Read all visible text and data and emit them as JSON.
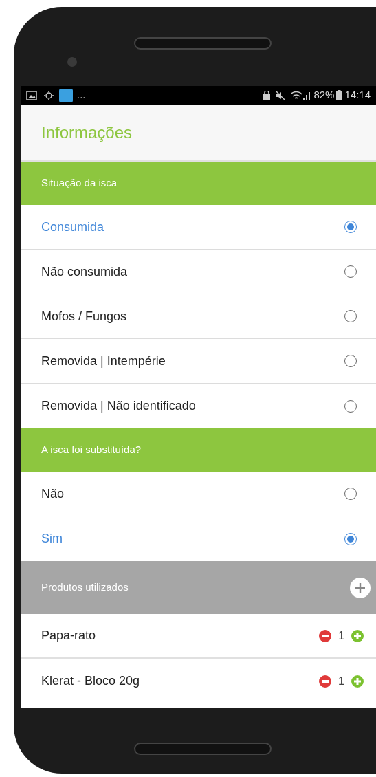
{
  "status_bar": {
    "overflow": "...",
    "battery": "82%",
    "time": "14:14"
  },
  "header": {
    "title": "Informações"
  },
  "sections": [
    {
      "kind": "radio",
      "title": "Situação da isca",
      "options": [
        {
          "label": "Consumida",
          "selected": true
        },
        {
          "label": "Não consumida",
          "selected": false
        },
        {
          "label": "Mofos / Fungos",
          "selected": false
        },
        {
          "label": "Removida | Intempérie",
          "selected": false
        },
        {
          "label": "Removida | Não identificado",
          "selected": false
        }
      ]
    },
    {
      "kind": "radio",
      "title": "A isca foi substituída?",
      "options": [
        {
          "label": "Não",
          "selected": false
        },
        {
          "label": "Sim",
          "selected": true
        }
      ]
    },
    {
      "kind": "products",
      "title": "Produtos utilizados",
      "products": [
        {
          "name": "Papa-rato",
          "quantity": "1"
        },
        {
          "name": "Klerat - Bloco 20g",
          "quantity": "1"
        }
      ]
    }
  ]
}
